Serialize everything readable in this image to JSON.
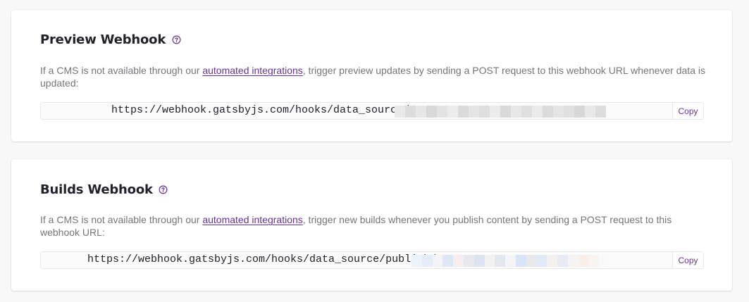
{
  "preview_webhook": {
    "title": "Preview Webhook",
    "desc_before": "If a CMS is not available through our ",
    "desc_link": "automated integrations",
    "desc_after": ", trigger preview updates by sending a POST request to this webhook URL whenever data is updated:",
    "url": "https://webhook.gatsbyjs.com/hooks/data_source/",
    "copy_label": "Copy"
  },
  "builds_webhook": {
    "title": "Builds Webhook",
    "desc_before": "If a CMS is not available through our ",
    "desc_link": "automated integrations",
    "desc_after": ", trigger new builds whenever you publish content by sending a POST request to this webhook URL:",
    "url": "https://webhook.gatsbyjs.com/hooks/data_source/publish/",
    "copy_label": "Copy"
  },
  "icons": {
    "help": "help-circle-icon"
  },
  "colors": {
    "accent": "#663399",
    "title": "#232129",
    "text": "#78757a"
  }
}
